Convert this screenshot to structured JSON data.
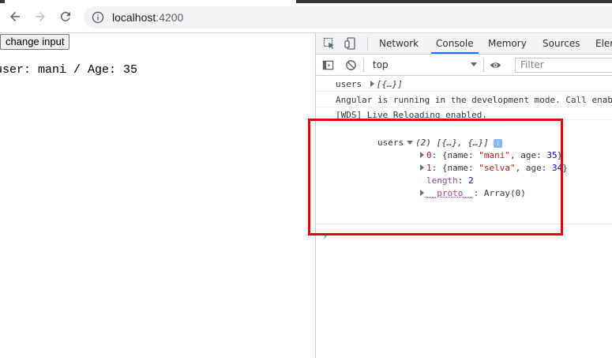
{
  "browser": {
    "url_host": "localhost",
    "url_port": ":4200"
  },
  "page": {
    "button_label": "change input",
    "user_text": "user: mani / Age: 35"
  },
  "devtools": {
    "tabs": [
      "Network",
      "Console",
      "Memory",
      "Sources",
      "Elem"
    ],
    "active_tab": "Console",
    "context": "top",
    "filter_placeholder": "Filter",
    "console": {
      "line1_label": "users",
      "line1_value": "[{…}]",
      "line2": "Angular is running in the development mode. Call enab",
      "line3": "[WDS] Live Reloading enabled.",
      "expanded_label": "users",
      "expanded_summary": "(2) [{…}, {…}]",
      "info_badge": "i",
      "item0_index": "0",
      "item0_name": "\"mani\"",
      "item0_age": "35",
      "item1_index": "1",
      "item1_name": "\"selva\"",
      "item1_age": "34",
      "length_key": "length",
      "length_value": "2",
      "proto_key": "__proto__",
      "proto_value": "Array(0)",
      "key_name": "name",
      "key_age": "age",
      "prompt": "›"
    }
  },
  "colors": {
    "highlight": "#e00000",
    "active_tab_underline": "#1a73e8"
  }
}
